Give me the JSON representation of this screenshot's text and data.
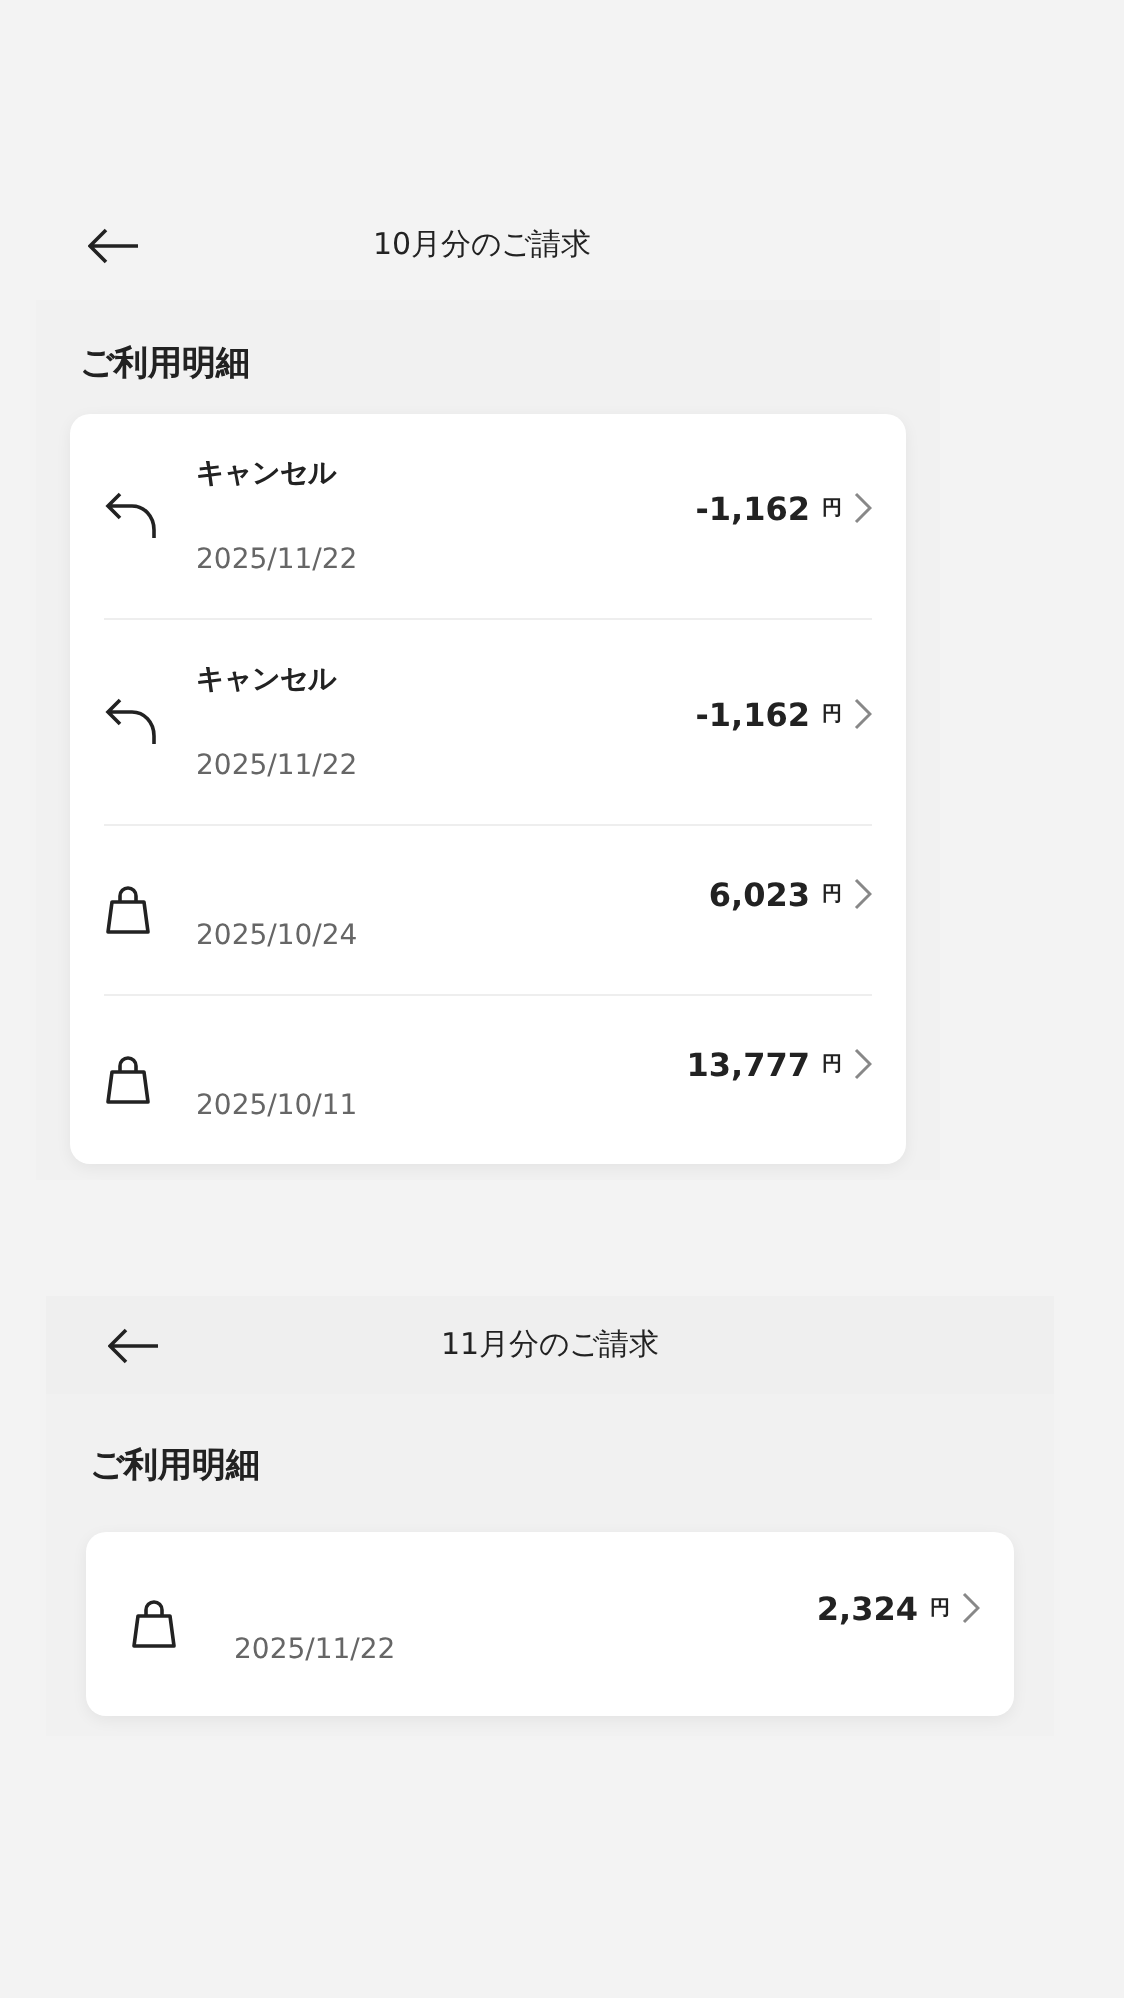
{
  "statements": [
    {
      "title": "10月分のご請求",
      "section_heading": "ご利用明細",
      "transactions": [
        {
          "kind": "cancel",
          "label": "キャンセル",
          "date": "2025/11/22",
          "amount": "-1,162",
          "currency": "円"
        },
        {
          "kind": "cancel",
          "label": "キャンセル",
          "date": "2025/11/22",
          "amount": "-1,162",
          "currency": "円"
        },
        {
          "kind": "purchase",
          "date": "2025/10/24",
          "amount": "6,023",
          "currency": "円"
        },
        {
          "kind": "purchase",
          "date": "2025/10/11",
          "amount": "13,777",
          "currency": "円"
        }
      ]
    },
    {
      "title": "11月分のご請求",
      "section_heading": "ご利用明細",
      "transactions": [
        {
          "kind": "purchase",
          "date": "2025/11/22",
          "amount": "2,324",
          "currency": "円"
        }
      ]
    }
  ]
}
